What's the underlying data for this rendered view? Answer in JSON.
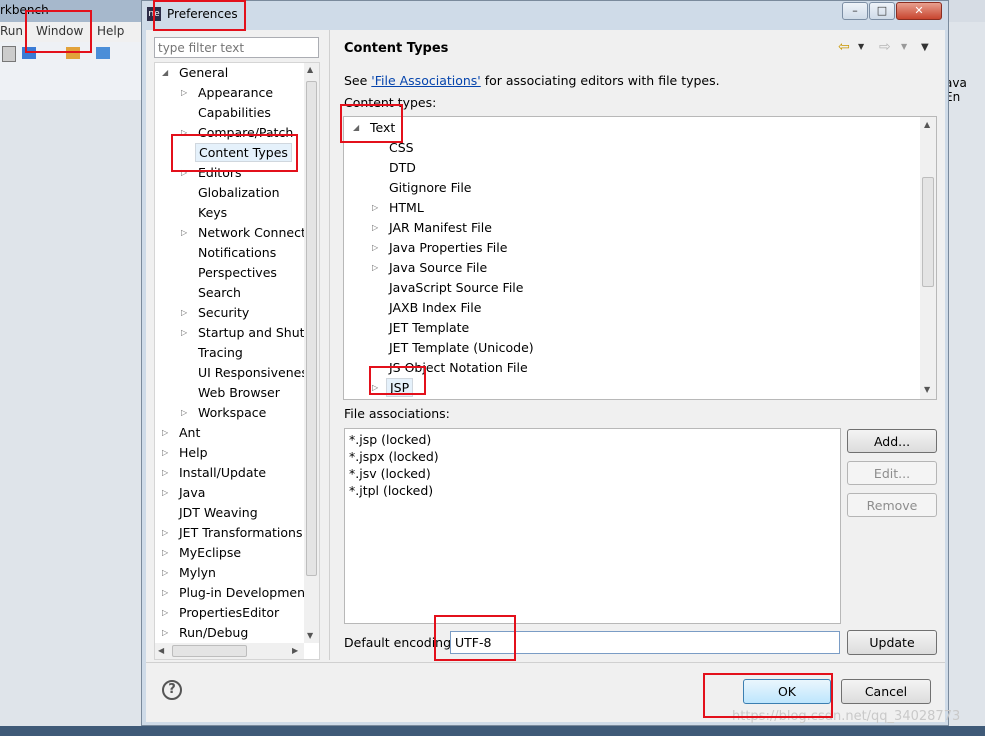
{
  "background": {
    "title_fragment": "rkbench",
    "menu": [
      "Run",
      "Window",
      "Help"
    ],
    "right_fragment": "ava En"
  },
  "dialog": {
    "title": "Preferences",
    "app_icon": "ne",
    "window_buttons": {
      "minimize": "–",
      "maximize": "□",
      "close": "✕"
    },
    "filter_placeholder": "type filter text"
  },
  "tree": [
    {
      "label": "General",
      "level": 0,
      "arrow": "expanded"
    },
    {
      "label": "Appearance",
      "level": 1,
      "arrow": "collapsed"
    },
    {
      "label": "Capabilities",
      "level": 1,
      "arrow": "none"
    },
    {
      "label": "Compare/Patch",
      "level": 1,
      "arrow": "collapsed"
    },
    {
      "label": "Content Types",
      "level": 1,
      "arrow": "none",
      "selected": true
    },
    {
      "label": "Editors",
      "level": 1,
      "arrow": "collapsed"
    },
    {
      "label": "Globalization",
      "level": 1,
      "arrow": "none"
    },
    {
      "label": "Keys",
      "level": 1,
      "arrow": "none"
    },
    {
      "label": "Network Connectio",
      "level": 1,
      "arrow": "collapsed"
    },
    {
      "label": "Notifications",
      "level": 1,
      "arrow": "none"
    },
    {
      "label": "Perspectives",
      "level": 1,
      "arrow": "none"
    },
    {
      "label": "Search",
      "level": 1,
      "arrow": "none"
    },
    {
      "label": "Security",
      "level": 1,
      "arrow": "collapsed"
    },
    {
      "label": "Startup and Shutd",
      "level": 1,
      "arrow": "collapsed"
    },
    {
      "label": "Tracing",
      "level": 1,
      "arrow": "none"
    },
    {
      "label": "UI Responsiveness",
      "level": 1,
      "arrow": "none"
    },
    {
      "label": "Web Browser",
      "level": 1,
      "arrow": "none"
    },
    {
      "label": "Workspace",
      "level": 1,
      "arrow": "collapsed"
    },
    {
      "label": "Ant",
      "level": 0,
      "arrow": "collapsed"
    },
    {
      "label": "Help",
      "level": 0,
      "arrow": "collapsed"
    },
    {
      "label": "Install/Update",
      "level": 0,
      "arrow": "collapsed"
    },
    {
      "label": "Java",
      "level": 0,
      "arrow": "collapsed"
    },
    {
      "label": "JDT Weaving",
      "level": 0,
      "arrow": "none"
    },
    {
      "label": "JET Transformations",
      "level": 0,
      "arrow": "collapsed"
    },
    {
      "label": "MyEclipse",
      "level": 0,
      "arrow": "collapsed"
    },
    {
      "label": "Mylyn",
      "level": 0,
      "arrow": "collapsed"
    },
    {
      "label": "Plug-in Development",
      "level": 0,
      "arrow": "collapsed"
    },
    {
      "label": "PropertiesEditor",
      "level": 0,
      "arrow": "collapsed"
    },
    {
      "label": "Run/Debug",
      "level": 0,
      "arrow": "collapsed"
    }
  ],
  "page": {
    "title": "Content Types",
    "see_prefix": "See ",
    "see_link": "'File Associations'",
    "see_suffix": " for associating editors with file types.",
    "content_types_label": "Content types:",
    "content_types": [
      {
        "label": "Text",
        "level": 0,
        "arrow": "expanded"
      },
      {
        "label": "CSS",
        "level": 1,
        "arrow": "none"
      },
      {
        "label": "DTD",
        "level": 1,
        "arrow": "none"
      },
      {
        "label": "Gitignore File",
        "level": 1,
        "arrow": "none"
      },
      {
        "label": "HTML",
        "level": 1,
        "arrow": "collapsed"
      },
      {
        "label": "JAR Manifest File",
        "level": 1,
        "arrow": "collapsed"
      },
      {
        "label": "Java Properties File",
        "level": 1,
        "arrow": "collapsed"
      },
      {
        "label": "Java Source File",
        "level": 1,
        "arrow": "collapsed"
      },
      {
        "label": "JavaScript Source File",
        "level": 1,
        "arrow": "none"
      },
      {
        "label": "JAXB Index File",
        "level": 1,
        "arrow": "none"
      },
      {
        "label": "JET Template",
        "level": 1,
        "arrow": "none"
      },
      {
        "label": "JET Template (Unicode)",
        "level": 1,
        "arrow": "none"
      },
      {
        "label": "JS Object Notation File",
        "level": 1,
        "arrow": "none"
      },
      {
        "label": "JSP",
        "level": 1,
        "arrow": "collapsed",
        "selected": true
      }
    ],
    "file_assoc_label": "File associations:",
    "file_associations": [
      "*.jsp (locked)",
      "*.jspx (locked)",
      "*.jsv (locked)",
      "*.jtpl (locked)"
    ],
    "add_button": "Add...",
    "edit_button": "Edit...",
    "remove_button": "Remove",
    "encoding_label": "Default encoding:",
    "encoding_value": "UTF-8",
    "update_button": "Update"
  },
  "footer": {
    "help": "?",
    "ok": "OK",
    "cancel": "Cancel"
  },
  "watermark": "https://blog.csdn.net/qq_34028773",
  "colors": {
    "highlight_box": "#e3101b",
    "link": "#0645ad",
    "selection": "#e5f1fb"
  }
}
